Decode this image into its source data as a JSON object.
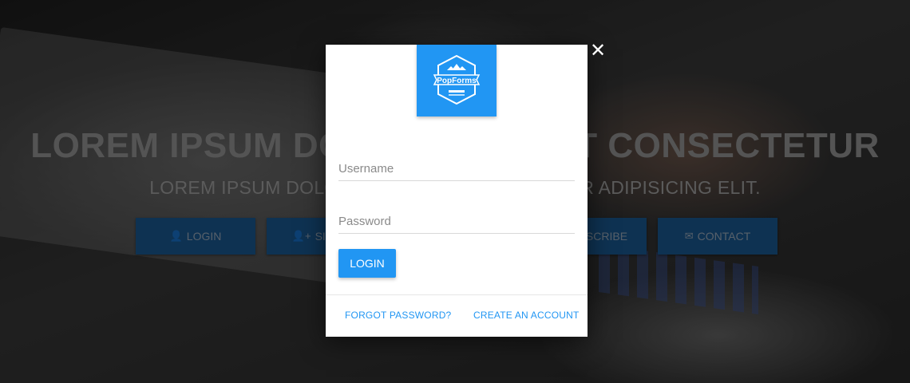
{
  "hero": {
    "title": "LOREM IPSUM DOLOR SIT AMET CONSECTETUR",
    "subtitle": "LOREM IPSUM DOLOR SIT AMET, CONSECTETUR ADIPISICING ELIT.",
    "buttons": [
      {
        "label": "LOGIN",
        "icon": "user-icon"
      },
      {
        "label": "SIGN UP",
        "icon": "user-plus-icon"
      },
      {
        "label": "SUBSCRIBE",
        "icon": "bell-icon"
      },
      {
        "label": "CONTACT",
        "icon": "envelope-icon"
      }
    ]
  },
  "modal": {
    "logo_text": "PopForms",
    "close_icon": "close-icon",
    "username_placeholder": "Username",
    "password_placeholder": "Password",
    "login_label": "LOGIN",
    "forgot_label": "FORGOT PASSWORD?",
    "create_label": "CREATE AN ACCOUNT"
  },
  "colors": {
    "accent": "#2196f3",
    "hero_button": "#1b5c95"
  }
}
